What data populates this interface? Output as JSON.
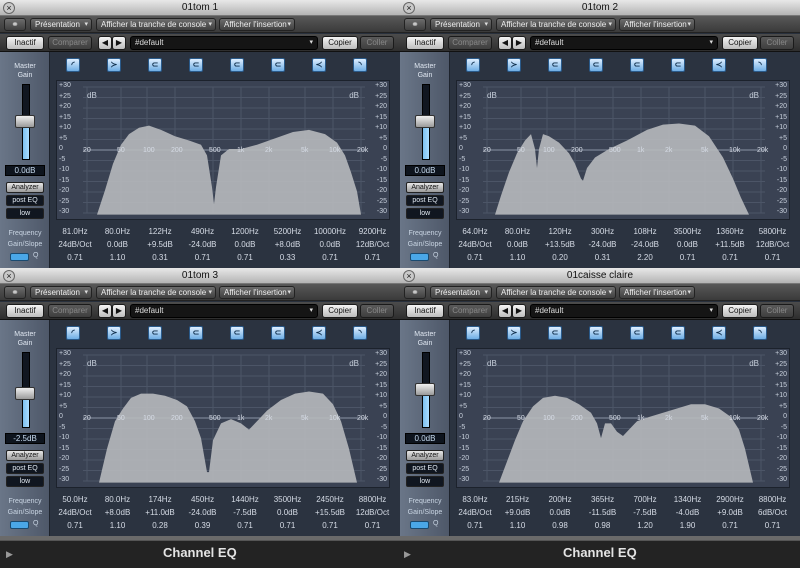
{
  "toolbar": {
    "link_icon": "link-icon",
    "menus": [
      "Présentation",
      "Afficher la tranche de console",
      "Afficher l'insertion"
    ],
    "bypass": "Inactif",
    "compare": "Comparer",
    "nav": [
      "◀",
      "▶"
    ],
    "preset": "#default",
    "copy": "Copier",
    "paste": "Coller"
  },
  "left": {
    "master": "Master",
    "gain": "Gain",
    "analyzer": "Analyzer",
    "post": "post EQ",
    "low": "low"
  },
  "labels": {
    "frequency": "Frequency",
    "gainslope": "Gain/Slope",
    "q": "Q"
  },
  "scale": [
    "+30",
    "+25",
    "+20",
    "+15",
    "+10",
    "+5",
    "0",
    "-5",
    "-10",
    "-15",
    "-20",
    "-25",
    "-30"
  ],
  "db": "dB",
  "freq_axis": [
    "20",
    "50",
    "100",
    "200",
    "500",
    "1k",
    "2k",
    "5k",
    "10k",
    "20k"
  ],
  "band_icons": [
    "low-cut-icon",
    "low-shelf-icon",
    "peak-icon",
    "peak-icon",
    "peak-icon",
    "peak-icon",
    "high-shelf-icon",
    "high-cut-icon"
  ],
  "plugin": "Channel EQ",
  "windows": [
    {
      "title": "01tom 1",
      "master_gain": "0.0dB",
      "slider": 0.5,
      "freq": [
        "81.0Hz",
        "80.0Hz",
        "122Hz",
        "490Hz",
        "1200Hz",
        "5200Hz",
        "10000Hz",
        "9200Hz"
      ],
      "gain": [
        "24dB/Oct",
        "0.0dB",
        "+9.5dB",
        "-24.0dB",
        "0.0dB",
        "+8.0dB",
        "0.0dB",
        "12dB/Oct"
      ],
      "q": [
        "0.71",
        "1.10",
        "0.31",
        "0.71",
        "0.71",
        "0.33",
        "0.71",
        "0.71"
      ]
    },
    {
      "title": "01tom 2",
      "master_gain": "0.0dB",
      "slider": 0.5,
      "freq": [
        "64.0Hz",
        "80.0Hz",
        "120Hz",
        "300Hz",
        "108Hz",
        "3500Hz",
        "1360Hz",
        "5800Hz"
      ],
      "gain": [
        "24dB/Oct",
        "0.0dB",
        "+13.5dB",
        "-24.0dB",
        "-24.0dB",
        "0.0dB",
        "+11.5dB",
        "12dB/Oct"
      ],
      "q": [
        "0.71",
        "1.10",
        "0.20",
        "0.31",
        "2.20",
        "0.71",
        "0.71",
        "0.71"
      ]
    },
    {
      "title": "01tom 3",
      "master_gain": "-2.5dB",
      "slider": 0.45,
      "freq": [
        "50.0Hz",
        "80.0Hz",
        "174Hz",
        "450Hz",
        "1440Hz",
        "3500Hz",
        "2450Hz",
        "8800Hz"
      ],
      "gain": [
        "24dB/Oct",
        "+8.0dB",
        "+11.0dB",
        "-24.0dB",
        "-7.5dB",
        "0.0dB",
        "+15.5dB",
        "12dB/Oct"
      ],
      "q": [
        "0.71",
        "1.10",
        "0.28",
        "0.39",
        "0.71",
        "0.71",
        "0.71",
        "0.71"
      ]
    },
    {
      "title": "01caisse claire",
      "master_gain": "0.0dB",
      "slider": 0.5,
      "freq": [
        "83.0Hz",
        "215Hz",
        "200Hz",
        "365Hz",
        "700Hz",
        "1340Hz",
        "2900Hz",
        "8800Hz"
      ],
      "gain": [
        "24dB/Oct",
        "+9.0dB",
        "0.0dB",
        "-11.5dB",
        "-7.5dB",
        "-4.0dB",
        "+9.0dB",
        "6dB/Oct"
      ],
      "q": [
        "0.71",
        "1.10",
        "0.98",
        "0.98",
        "1.20",
        "1.90",
        "0.71",
        "0.71"
      ]
    }
  ]
}
